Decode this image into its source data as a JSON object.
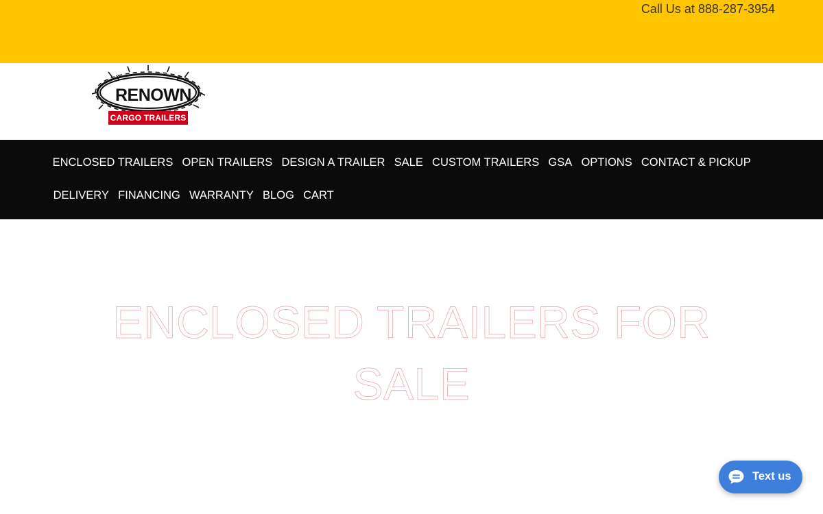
{
  "header": {
    "phone_text": "Call Us at 888-287-3954"
  },
  "logo": {
    "wordmark": "RENOWN",
    "subtitle": "CARGO TRAILERS"
  },
  "nav": {
    "row1": [
      "ENCLOSED TRAILERS",
      "OPEN TRAILERS",
      "DESIGN A TRAILER",
      "SALE",
      "CUSTOM TRAILERS",
      "GSA",
      "OPTIONS",
      "CONTACT & PICKUP"
    ],
    "row2": [
      "DELIVERY",
      "FINANCING",
      "WARRANTY",
      "BLOG",
      "CART"
    ]
  },
  "hero": {
    "title": "ENCLOSED TRAILERS FOR SALE"
  },
  "chat_widget": {
    "label": "Text us",
    "icon": "chat-bubble-icon"
  },
  "colors": {
    "topbar": "#ffc600",
    "nav_background": "#0b0b0b",
    "logo_red": "#d0021b",
    "chat_button": "#3e7fdc"
  }
}
